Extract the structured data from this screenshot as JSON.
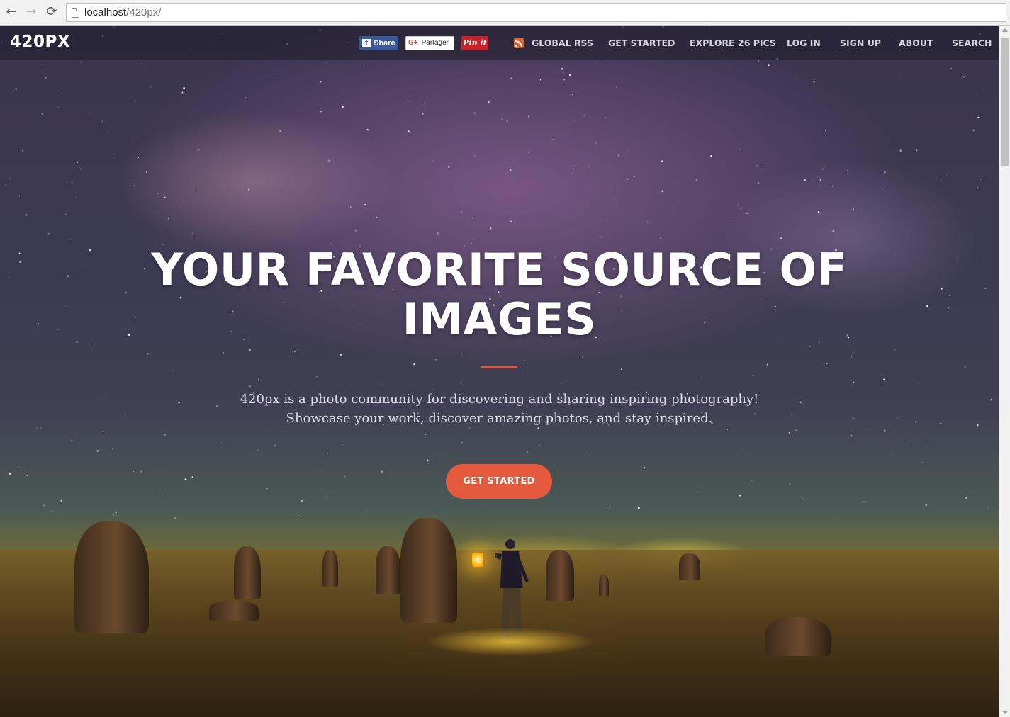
{
  "browser": {
    "url_host": "localhost",
    "url_path": "/420px/"
  },
  "nav": {
    "logo": "420PX",
    "share_facebook": "Share",
    "share_google": "Partager",
    "share_pinterest": "Pin it",
    "links": [
      "GLOBAL RSS",
      "GET STARTED",
      "EXPLORE 26 PICS",
      "LOG IN",
      "SIGN UP",
      "ABOUT",
      "SEARCH"
    ]
  },
  "hero": {
    "title_lines": [
      "YOUR FAVORITE SOURCE OF",
      "IMAGES"
    ],
    "description_lines": [
      "420px is a photo community for discovering and sharing inspiring photography!",
      "Showcase your work, discover amazing photos, and stay inspired."
    ],
    "cta_label": "GET STARTED"
  },
  "colors": {
    "accent": "#e55a3d",
    "facebook": "#3b5998",
    "pinterest": "#cb2027",
    "rss": "#e0632b"
  }
}
